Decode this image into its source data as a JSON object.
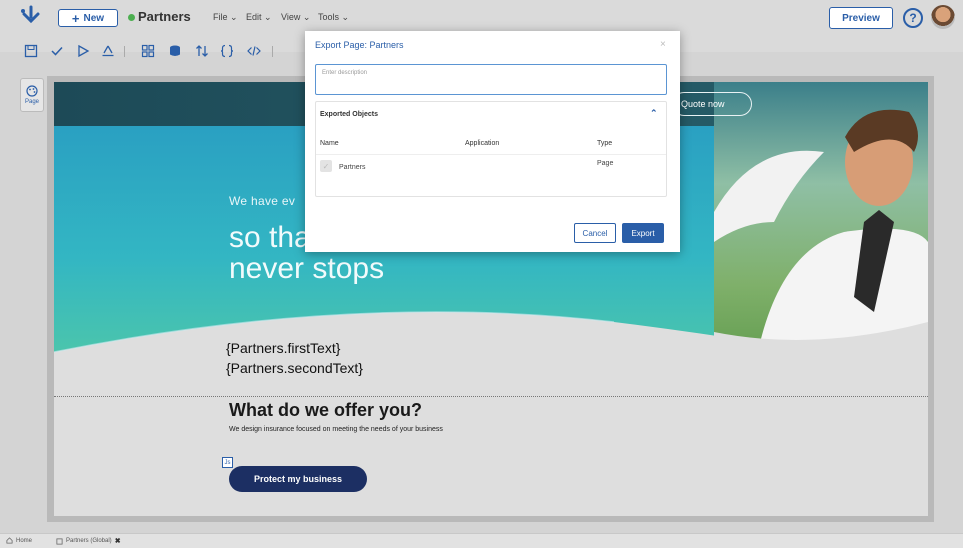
{
  "header": {
    "new_label": "New",
    "page_name": "Partners",
    "status_color": "#4caf50",
    "menus": [
      "File",
      "Edit",
      "View",
      "Tools"
    ],
    "preview_label": "Preview",
    "help_label": "?"
  },
  "toolbar": {
    "icons": [
      "save-icon",
      "check-icon",
      "play-icon",
      "deploy-icon",
      "components-icon",
      "database-icon",
      "sort-icon",
      "braces-icon",
      "code-icon"
    ]
  },
  "rail": {
    "page_label": "Page"
  },
  "canvas": {
    "quote_label": "Quote now",
    "hero_subtitle": "We have ev",
    "hero_line1": "so tha",
    "hero_line2": "never stops",
    "first_text": "{Partners.firstText}",
    "second_text": "{Partners.secondText}",
    "offer_title": "What do we offer you?",
    "offer_text": "We design insurance focused on meeting the needs of your business",
    "small_icon_label": "Js",
    "protect_label": "Protect my business"
  },
  "dialog": {
    "title": "Export Page: Partners",
    "close": "×",
    "description_placeholder": "Enter description",
    "panel_title": "Exported Objects",
    "columns": [
      "Name",
      "Application",
      "Type"
    ],
    "rows": [
      {
        "name": "Partners",
        "application": "",
        "type": "Page"
      }
    ],
    "cancel_label": "Cancel",
    "export_label": "Export",
    "accent": "#2a5ea8"
  },
  "bottom_tabs": [
    {
      "label": "Home"
    },
    {
      "label": "Partners (Global)",
      "close": "✖"
    }
  ]
}
